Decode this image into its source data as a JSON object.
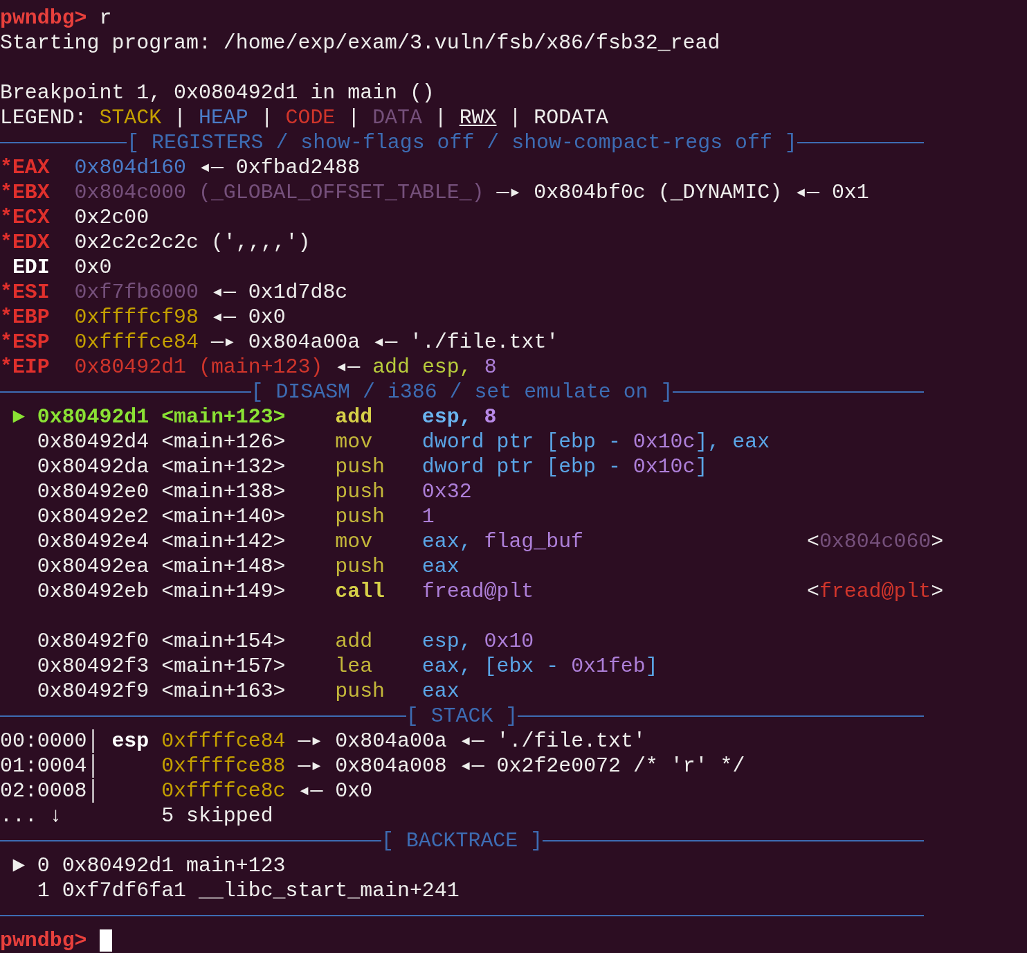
{
  "terminal": {
    "lines": [
      {
        "kind": "text",
        "segments": [
          {
            "t": "pwndbg>",
            "kind": "prompt"
          },
          {
            "t": " r",
            "kind": "plain"
          }
        ]
      },
      {
        "kind": "text",
        "segments": [
          {
            "t": "Starting program: /home/exp/exam/3.vuln/fsb/x86/fsb32_read",
            "kind": "plain"
          }
        ]
      },
      {
        "kind": "blank"
      },
      {
        "kind": "text",
        "segments": [
          {
            "t": "Breakpoint 1, 0x080492d1 in main ()",
            "kind": "plain"
          }
        ]
      },
      {
        "kind": "text",
        "segments": [
          {
            "t": "LEGEND: ",
            "kind": "plain"
          },
          {
            "t": "STACK",
            "kind": "stack"
          },
          {
            "t": " | ",
            "kind": "plain"
          },
          {
            "t": "HEAP",
            "kind": "heap"
          },
          {
            "t": " | ",
            "kind": "plain"
          },
          {
            "t": "CODE",
            "kind": "code"
          },
          {
            "t": " | ",
            "kind": "plain"
          },
          {
            "t": "DATA",
            "kind": "data"
          },
          {
            "t": " | ",
            "kind": "plain"
          },
          {
            "t": "RWX",
            "kind": "rwx"
          },
          {
            "t": " | RODATA",
            "kind": "plain"
          }
        ]
      },
      {
        "kind": "rule",
        "title": "[ REGISTERS / show-flags off / show-compact-regs off ]"
      },
      {
        "kind": "text",
        "segments": [
          {
            "t": "*EAX",
            "kind": "reg_changed"
          },
          {
            "t": "  0x804d160",
            "kind": "heap"
          },
          {
            "t": " ◂— 0xfbad2488",
            "kind": "plain"
          }
        ]
      },
      {
        "kind": "text",
        "segments": [
          {
            "t": "*EBX",
            "kind": "reg_changed"
          },
          {
            "t": "  0x804c000 (_GLOBAL_OFFSET_TABLE_)",
            "kind": "data"
          },
          {
            "t": " —▸ 0x804bf0c (_DYNAMIC) ◂— 0x1",
            "kind": "plain"
          }
        ]
      },
      {
        "kind": "text",
        "segments": [
          {
            "t": "*ECX",
            "kind": "reg_changed"
          },
          {
            "t": "  0x2c00",
            "kind": "plain"
          }
        ]
      },
      {
        "kind": "text",
        "segments": [
          {
            "t": "*EDX",
            "kind": "reg_changed"
          },
          {
            "t": "  0x2c2c2c2c (',,,,')",
            "kind": "plain"
          }
        ]
      },
      {
        "kind": "text",
        "segments": [
          {
            "t": " EDI",
            "kind": "reg"
          },
          {
            "t": "  0x0",
            "kind": "plain"
          }
        ]
      },
      {
        "kind": "text",
        "segments": [
          {
            "t": "*ESI",
            "kind": "reg_changed"
          },
          {
            "t": "  0xf7fb6000",
            "kind": "data"
          },
          {
            "t": " ◂— 0x1d7d8c",
            "kind": "plain"
          }
        ]
      },
      {
        "kind": "text",
        "segments": [
          {
            "t": "*EBP",
            "kind": "reg_changed"
          },
          {
            "t": "  0xffffcf98",
            "kind": "stack"
          },
          {
            "t": " ◂— 0x0",
            "kind": "plain"
          }
        ]
      },
      {
        "kind": "text",
        "segments": [
          {
            "t": "*ESP",
            "kind": "reg_changed"
          },
          {
            "t": "  0xffffce84",
            "kind": "stack"
          },
          {
            "t": " —▸ 0x804a00a ◂— './file.txt'",
            "kind": "plain"
          }
        ]
      },
      {
        "kind": "text",
        "segments": [
          {
            "t": "*EIP",
            "kind": "reg_changed"
          },
          {
            "t": "  0x80492d1 (main+123)",
            "kind": "code"
          },
          {
            "t": " ◂— ",
            "kind": "plain"
          },
          {
            "t": "add esp, ",
            "kind": "mnem_lime"
          },
          {
            "t": "8",
            "kind": "num"
          }
        ]
      },
      {
        "kind": "rule",
        "title": "[ DISASM / i386 / set emulate on ]"
      },
      {
        "kind": "text",
        "segments": [
          {
            "t": " ► 0x80492d1 <main+123>",
            "kind": "current"
          },
          {
            "t": "    add",
            "kind": "mnem_bold"
          },
          {
            "t": "    esp, ",
            "kind": "opnd_bold"
          },
          {
            "t": "8",
            "kind": "num_bold"
          }
        ]
      },
      {
        "kind": "text",
        "segments": [
          {
            "t": "   0x80492d4 <main+126>",
            "kind": "plain"
          },
          {
            "t": "    mov",
            "kind": "mnem"
          },
          {
            "t": "    dword ptr [ebp - ",
            "kind": "opnd"
          },
          {
            "t": "0x10c",
            "kind": "num"
          },
          {
            "t": "], eax",
            "kind": "opnd"
          }
        ]
      },
      {
        "kind": "text",
        "segments": [
          {
            "t": "   0x80492da <main+132>",
            "kind": "plain"
          },
          {
            "t": "    push",
            "kind": "mnem"
          },
          {
            "t": "   dword ptr [ebp - ",
            "kind": "opnd"
          },
          {
            "t": "0x10c",
            "kind": "num"
          },
          {
            "t": "]",
            "kind": "opnd"
          }
        ]
      },
      {
        "kind": "text",
        "segments": [
          {
            "t": "   0x80492e0 <main+138>",
            "kind": "plain"
          },
          {
            "t": "    push",
            "kind": "mnem"
          },
          {
            "t": "   0x32",
            "kind": "num"
          }
        ]
      },
      {
        "kind": "text",
        "segments": [
          {
            "t": "   0x80492e2 <main+140>",
            "kind": "plain"
          },
          {
            "t": "    push",
            "kind": "mnem"
          },
          {
            "t": "   1",
            "kind": "num"
          }
        ]
      },
      {
        "kind": "text",
        "segments": [
          {
            "t": "   0x80492e4 <main+142>",
            "kind": "plain"
          },
          {
            "t": "    mov",
            "kind": "mnem"
          },
          {
            "t": "    eax, ",
            "kind": "opnd"
          },
          {
            "t": "flag_buf",
            "kind": "num"
          },
          {
            "t": "                  <",
            "kind": "plain"
          },
          {
            "t": "0x804c060",
            "kind": "data"
          },
          {
            "t": ">",
            "kind": "plain"
          }
        ]
      },
      {
        "kind": "text",
        "segments": [
          {
            "t": "   0x80492ea <main+148>",
            "kind": "plain"
          },
          {
            "t": "    push",
            "kind": "mnem"
          },
          {
            "t": "   eax",
            "kind": "opnd"
          }
        ]
      },
      {
        "kind": "text",
        "segments": [
          {
            "t": "   0x80492eb <main+149>",
            "kind": "plain"
          },
          {
            "t": "    call",
            "kind": "mnem_bold"
          },
          {
            "t": "   fread@plt",
            "kind": "num"
          },
          {
            "t": "                      <",
            "kind": "plain"
          },
          {
            "t": "fread@plt",
            "kind": "code"
          },
          {
            "t": ">",
            "kind": "plain"
          }
        ]
      },
      {
        "kind": "blank"
      },
      {
        "kind": "text",
        "segments": [
          {
            "t": "   0x80492f0 <main+154>",
            "kind": "plain"
          },
          {
            "t": "    add",
            "kind": "mnem"
          },
          {
            "t": "    esp, ",
            "kind": "opnd"
          },
          {
            "t": "0x10",
            "kind": "num"
          }
        ]
      },
      {
        "kind": "text",
        "segments": [
          {
            "t": "   0x80492f3 <main+157>",
            "kind": "plain"
          },
          {
            "t": "    lea",
            "kind": "mnem"
          },
          {
            "t": "    eax, [ebx - ",
            "kind": "opnd"
          },
          {
            "t": "0x1feb",
            "kind": "num"
          },
          {
            "t": "]",
            "kind": "opnd"
          }
        ]
      },
      {
        "kind": "text",
        "segments": [
          {
            "t": "   0x80492f9 <main+163>",
            "kind": "plain"
          },
          {
            "t": "    push",
            "kind": "mnem"
          },
          {
            "t": "   eax",
            "kind": "opnd"
          }
        ]
      },
      {
        "kind": "rule",
        "title": "[ STACK ]"
      },
      {
        "kind": "text",
        "segments": [
          {
            "t": "00:0000│ ",
            "kind": "plain"
          },
          {
            "t": "esp",
            "kind": "reg"
          },
          {
            "t": " 0xffffce84",
            "kind": "stack"
          },
          {
            "t": " —▸ 0x804a00a ◂— './file.txt'",
            "kind": "plain"
          }
        ]
      },
      {
        "kind": "text",
        "segments": [
          {
            "t": "01:0004│",
            "kind": "plain"
          },
          {
            "t": "     0xffffce88",
            "kind": "stack"
          },
          {
            "t": " —▸ 0x804a008 ◂— 0x2f2e0072 /* 'r' */",
            "kind": "plain"
          }
        ]
      },
      {
        "kind": "text",
        "segments": [
          {
            "t": "02:0008│",
            "kind": "plain"
          },
          {
            "t": "     0xffffce8c",
            "kind": "stack"
          },
          {
            "t": " ◂— 0x0",
            "kind": "plain"
          }
        ]
      },
      {
        "kind": "text",
        "segments": [
          {
            "t": "... ↓        5 skipped",
            "kind": "plain"
          }
        ]
      },
      {
        "kind": "rule",
        "title": "[ BACKTRACE ]"
      },
      {
        "kind": "text",
        "segments": [
          {
            "t": " ► 0 0x80492d1 main+123",
            "kind": "plain"
          }
        ]
      },
      {
        "kind": "text",
        "segments": [
          {
            "t": "   1 0xf7df6fa1 __libc_start_main+241",
            "kind": "plain"
          }
        ]
      },
      {
        "kind": "rule"
      },
      {
        "kind": "text",
        "cursor": true,
        "segments": [
          {
            "t": "pwndbg>",
            "kind": "prompt"
          }
        ]
      }
    ]
  }
}
